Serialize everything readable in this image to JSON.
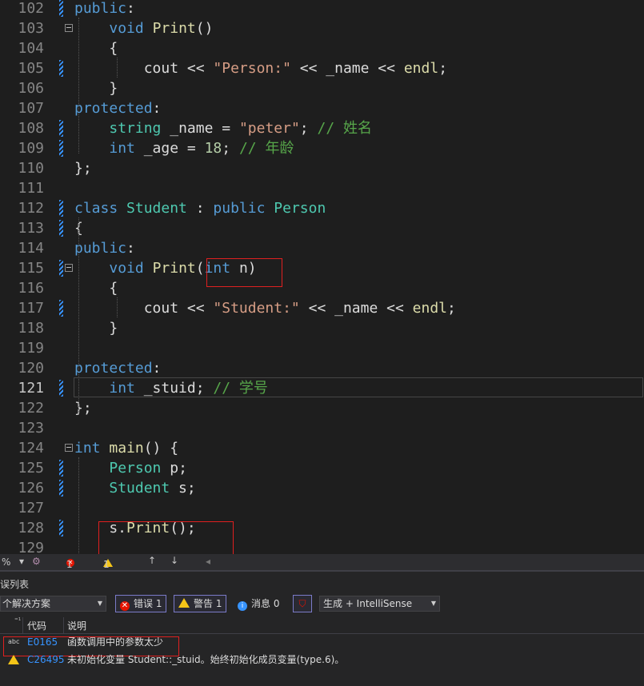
{
  "editor": {
    "lines": [
      {
        "num": "102",
        "tokens": [
          [
            "kw",
            "public"
          ],
          [
            "id",
            ":"
          ]
        ]
      },
      {
        "num": "103",
        "tokens": [
          [
            "id",
            "    "
          ],
          [
            "kw",
            "void"
          ],
          [
            "id",
            " "
          ],
          [
            "fn",
            "Print"
          ],
          [
            "id",
            "()"
          ]
        ]
      },
      {
        "num": "104",
        "tokens": [
          [
            "id",
            "    {"
          ]
        ]
      },
      {
        "num": "105",
        "tokens": [
          [
            "id",
            "        cout << "
          ],
          [
            "st",
            "\"Person:\""
          ],
          [
            "id",
            " << _name << "
          ],
          [
            "fn",
            "endl"
          ],
          [
            "id",
            ";"
          ]
        ]
      },
      {
        "num": "106",
        "tokens": [
          [
            "id",
            "    }"
          ]
        ]
      },
      {
        "num": "107",
        "tokens": [
          [
            "kw",
            "protected"
          ],
          [
            "id",
            ":"
          ]
        ]
      },
      {
        "num": "108",
        "tokens": [
          [
            "id",
            "    "
          ],
          [
            "ty",
            "string"
          ],
          [
            "id",
            " _name = "
          ],
          [
            "st",
            "\"peter\""
          ],
          [
            "id",
            "; "
          ],
          [
            "cm",
            "// 姓名"
          ]
        ]
      },
      {
        "num": "109",
        "tokens": [
          [
            "id",
            "    "
          ],
          [
            "kw",
            "int"
          ],
          [
            "id",
            " _age = "
          ],
          [
            "nm",
            "18"
          ],
          [
            "id",
            "; "
          ],
          [
            "cm",
            "// 年龄"
          ]
        ]
      },
      {
        "num": "110",
        "tokens": [
          [
            "id",
            "};"
          ]
        ]
      },
      {
        "num": "111",
        "tokens": []
      },
      {
        "num": "112",
        "tokens": [
          [
            "kw",
            "class"
          ],
          [
            "id",
            " "
          ],
          [
            "ty",
            "Student"
          ],
          [
            "id",
            " : "
          ],
          [
            "kw",
            "public"
          ],
          [
            "id",
            " "
          ],
          [
            "ty",
            "Person"
          ]
        ]
      },
      {
        "num": "113",
        "tokens": [
          [
            "id",
            "{"
          ]
        ]
      },
      {
        "num": "114",
        "tokens": [
          [
            "kw",
            "public"
          ],
          [
            "id",
            ":"
          ]
        ]
      },
      {
        "num": "115",
        "tokens": [
          [
            "id",
            "    "
          ],
          [
            "kw",
            "void"
          ],
          [
            "id",
            " "
          ],
          [
            "fn",
            "Print"
          ],
          [
            "id",
            "("
          ],
          [
            "kw",
            "int"
          ],
          [
            "id",
            " n)"
          ]
        ]
      },
      {
        "num": "116",
        "tokens": [
          [
            "id",
            "    {"
          ]
        ]
      },
      {
        "num": "117",
        "tokens": [
          [
            "id",
            "        cout << "
          ],
          [
            "st",
            "\"Student:\""
          ],
          [
            "id",
            " << _name << "
          ],
          [
            "fn",
            "endl"
          ],
          [
            "id",
            ";"
          ]
        ]
      },
      {
        "num": "118",
        "tokens": [
          [
            "id",
            "    }"
          ]
        ]
      },
      {
        "num": "119",
        "tokens": []
      },
      {
        "num": "120",
        "tokens": [
          [
            "kw",
            "protected"
          ],
          [
            "id",
            ":"
          ]
        ]
      },
      {
        "num": "121",
        "tokens": [
          [
            "id",
            "    "
          ],
          [
            "kw",
            "int"
          ],
          [
            "id",
            " _stuid; "
          ],
          [
            "cm",
            "// 学号"
          ]
        ]
      },
      {
        "num": "122",
        "tokens": [
          [
            "id",
            "};"
          ]
        ]
      },
      {
        "num": "123",
        "tokens": []
      },
      {
        "num": "124",
        "tokens": [
          [
            "kw",
            "int"
          ],
          [
            "id",
            " "
          ],
          [
            "fn",
            "main"
          ],
          [
            "id",
            "() {"
          ]
        ]
      },
      {
        "num": "125",
        "tokens": [
          [
            "id",
            "    "
          ],
          [
            "ty",
            "Person"
          ],
          [
            "id",
            " p;"
          ]
        ]
      },
      {
        "num": "126",
        "tokens": [
          [
            "id",
            "    "
          ],
          [
            "ty",
            "Student"
          ],
          [
            "id",
            " s;"
          ]
        ]
      },
      {
        "num": "127",
        "tokens": []
      },
      {
        "num": "128",
        "tokens": [
          [
            "id",
            "    s."
          ],
          [
            "fn",
            "Print"
          ],
          [
            "id",
            "();"
          ]
        ]
      },
      {
        "num": "129",
        "tokens": []
      }
    ]
  },
  "status": {
    "zoom": "%",
    "errors": "1",
    "warnings": "1"
  },
  "panel": {
    "title": "误列表",
    "scope": "个解决方案",
    "errors_btn": "错误 1",
    "warnings_btn": "警告 1",
    "messages_btn": "消息 0",
    "build_filter": "生成 + IntelliSense",
    "col_code": "代码",
    "col_desc": "说明",
    "rows": [
      {
        "icon": "abc",
        "code": "E0165",
        "desc": "函数调用中的参数太少"
      },
      {
        "icon": "warning",
        "code": "C26495",
        "desc": "未初始化变量 Student::_stuid。始终初始化成员变量(type.6)。"
      }
    ]
  },
  "colors": {
    "keyword": "#569cd6",
    "type": "#4ec9b0",
    "function": "#dcdcaa",
    "string": "#d69d85",
    "comment": "#57a64a",
    "number": "#b5cea8",
    "error_highlight": "#e02020"
  }
}
